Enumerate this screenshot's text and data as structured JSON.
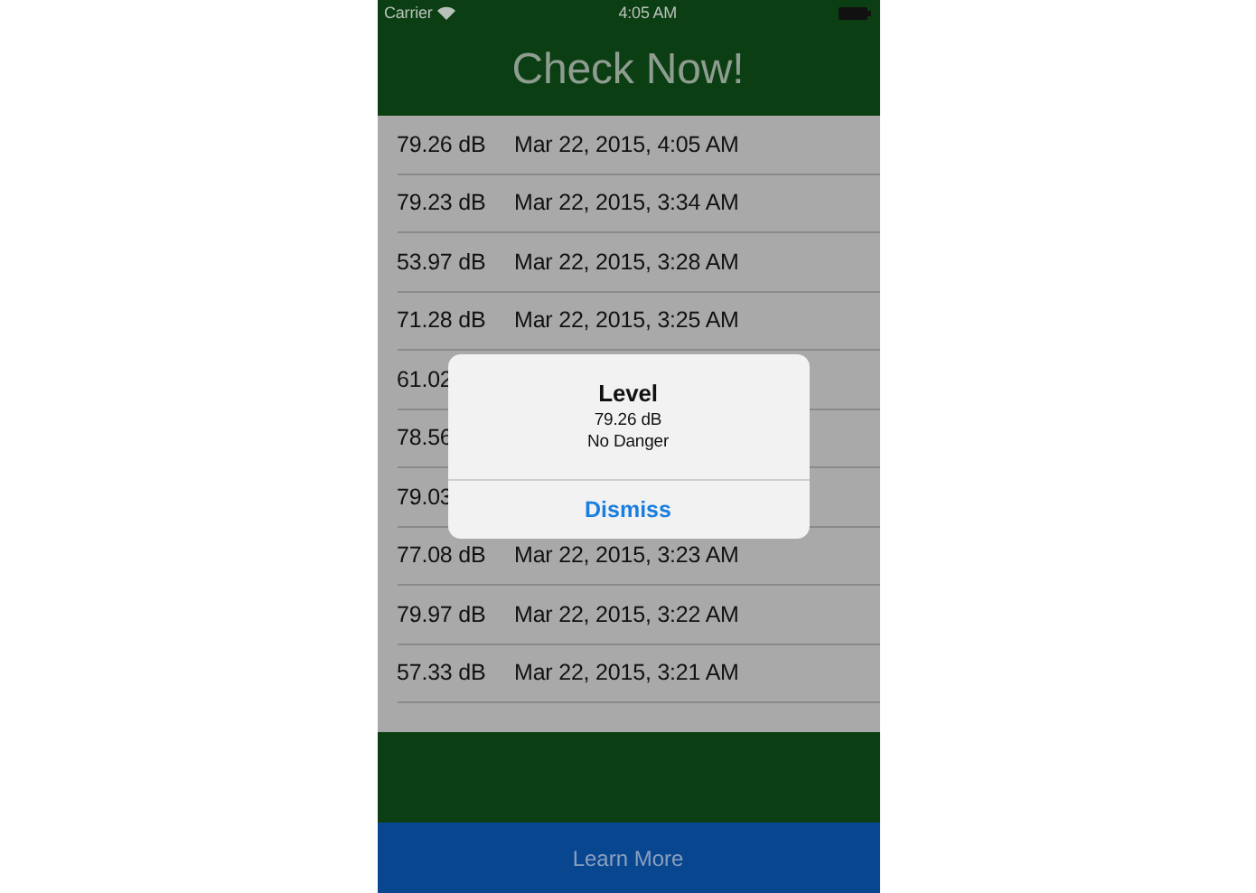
{
  "status_bar": {
    "carrier": "Carrier",
    "time": "4:05 AM"
  },
  "header": {
    "title": "Check Now!"
  },
  "readings": [
    {
      "level": "79.26 dB",
      "date": "Mar 22, 2015, 4:05 AM"
    },
    {
      "level": "79.23 dB",
      "date": "Mar 22, 2015, 3:34 AM"
    },
    {
      "level": "53.97 dB",
      "date": "Mar 22, 2015, 3:28 AM"
    },
    {
      "level": "71.28 dB",
      "date": "Mar 22, 2015, 3:25 AM"
    },
    {
      "level": "61.02"
    },
    {
      "level": "78.56"
    },
    {
      "level": "79.03"
    },
    {
      "level": "77.08 dB",
      "date": "Mar 22, 2015, 3:23 AM"
    },
    {
      "level": "79.97 dB",
      "date": "Mar 22, 2015, 3:22 AM"
    },
    {
      "level": "57.33 dB",
      "date": "Mar 22, 2015, 3:21 AM"
    }
  ],
  "footer_button": "Learn More",
  "alert": {
    "title": "Level",
    "lines": [
      "79.26 dB",
      "No Danger"
    ],
    "button": "Dismiss"
  }
}
